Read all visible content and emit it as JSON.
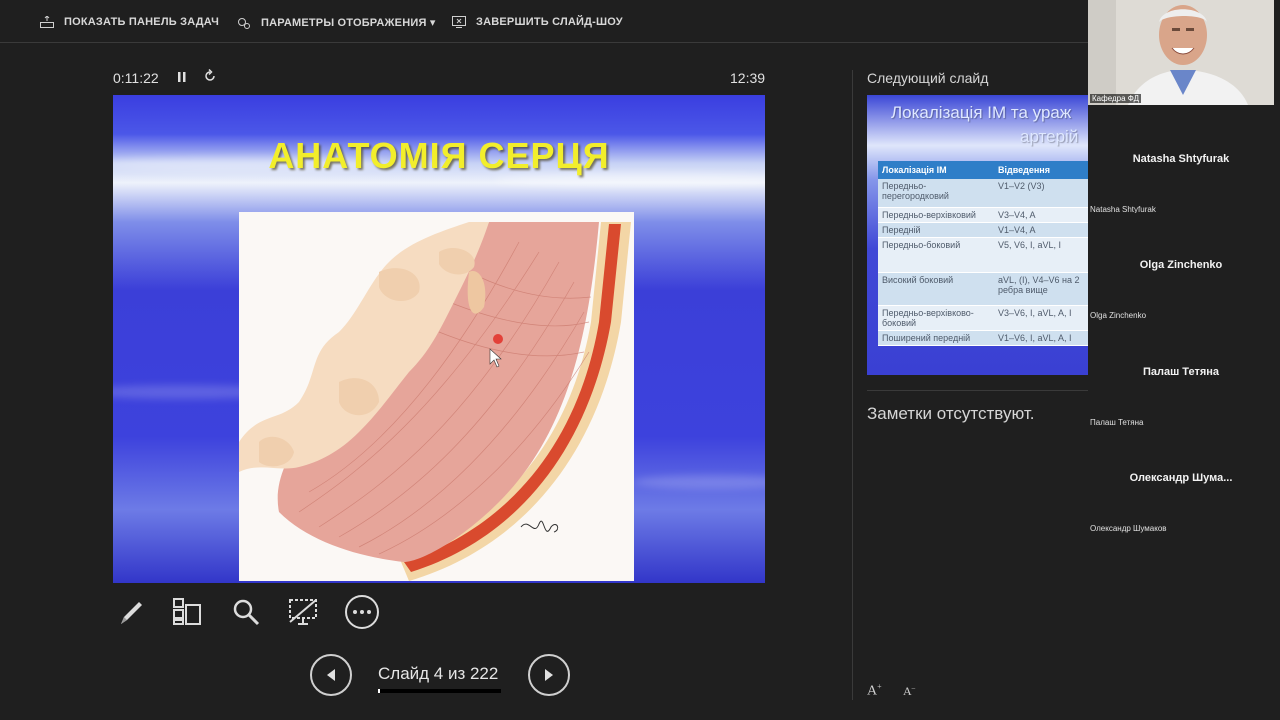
{
  "toolbar": {
    "show_taskbar": "ПОКАЗАТЬ ПАНЕЛЬ ЗАДАЧ",
    "display_settings": "ПАРАМЕТРЫ ОТОБРАЖЕНИЯ ▾",
    "end_slideshow": "ЗАВЕРШИТЬ СЛАЙД-ШОУ"
  },
  "timer": {
    "elapsed": "0:11:22",
    "clock": "12:39"
  },
  "slide": {
    "title": "АНАТОМІЯ СЕРЦЯ"
  },
  "navigation": {
    "counter": "Слайд 4 из 222",
    "progress_fraction": 0.018
  },
  "next_panel": {
    "label": "Следующий слайд",
    "slide_title_line1": "Локалізація ІМ та ураж",
    "slide_title_line2": "артерій",
    "table_headers": [
      "Локалізація ІМ",
      "Відведення"
    ],
    "table_rows": [
      [
        "Передньо-перегородковий",
        "V1–V2 (V3)"
      ],
      [
        "Передньо-верхівковий",
        "V3–V4, A"
      ],
      [
        "Передній",
        "V1–V4, A"
      ],
      [
        "Передньо-боковий",
        "V5, V6, I, aVL, I"
      ],
      [
        "Високий боковий",
        "aVL, (I), V4–V6 на 2 ребра вище"
      ],
      [
        "Передньо-верхівково-боковий",
        "V3–V6, I, aVL, A, I"
      ],
      [
        "Поширений передній",
        "V1–V6, I, aVL, A, I"
      ]
    ]
  },
  "notes": {
    "text": "Заметки отсутствуют."
  },
  "font_controls": {
    "increase": "A",
    "decrease": "A"
  },
  "participants": {
    "camera_label": "Кафедра ФД",
    "list": [
      {
        "name": "Natasha Shtyfurak",
        "sub": "Natasha Shtyfurak"
      },
      {
        "name": "Olga Zinchenko",
        "sub": "Olga Zinchenko"
      },
      {
        "name": "Палаш Тетяна",
        "sub": "Палаш Тетяна"
      },
      {
        "name": "Олександр  Шума...",
        "sub": "Олександр Шумаков"
      }
    ]
  },
  "colors": {
    "background": "#1f1f1f",
    "title_yellow": "#f2ee2b",
    "slide_blue": "#3b3fd8",
    "table_header": "#2f7ec8"
  }
}
